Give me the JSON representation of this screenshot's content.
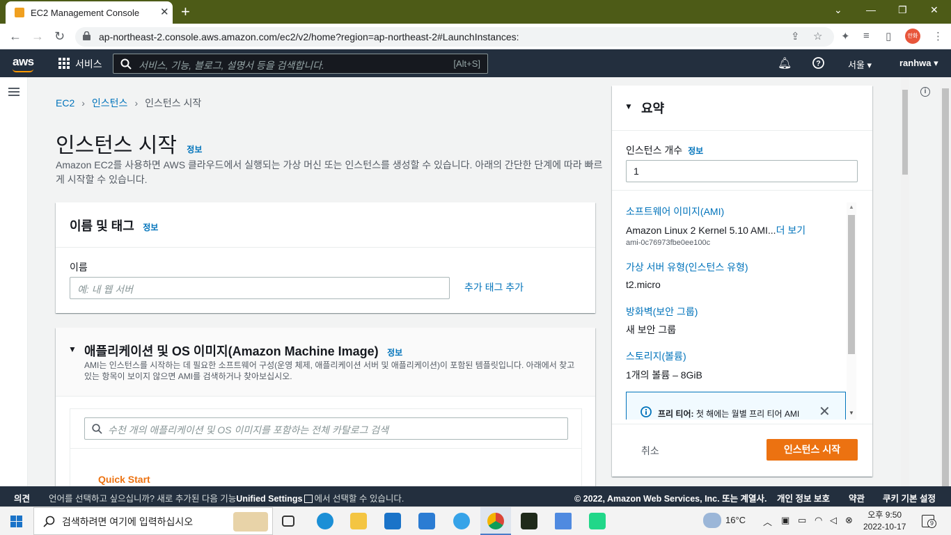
{
  "browser": {
    "tab_title": "EC2 Management Console",
    "tab_close": "✕",
    "new_tab": "+",
    "url": "ap-northeast-2.console.aws.amazon.com/ec2/v2/home?region=ap-northeast-2#LaunchInstances:",
    "profile_label": "란화",
    "window_controls": [
      "⌄",
      "—",
      "❐",
      "✕"
    ]
  },
  "aws_header": {
    "logo": "aws",
    "services_label": "서비스",
    "search_placeholder": "서비스, 기능, 블로그, 설명서 등을 검색합니다.",
    "search_shortcut": "[Alt+S]",
    "region": "서울 ▾",
    "user": "ranhwa ▾"
  },
  "breadcrumb": [
    "EC2",
    "인스턴스",
    "인스턴스 시작"
  ],
  "page": {
    "title": "인스턴스 시작",
    "info": "정보",
    "description": "Amazon EC2를 사용하면 AWS 클라우드에서 실행되는 가상 머신 또는 인스턴스를 생성할 수 있습니다. 아래의 간단한 단계에 따라 빠르게 시작할 수 있습니다."
  },
  "name_tags": {
    "header": "이름 및 태그",
    "info": "정보",
    "name_label": "이름",
    "name_placeholder": "예: 내 웹 서버",
    "add_tag": "추가 태그 추가"
  },
  "ami": {
    "header": "애플리케이션 및 OS 이미지(Amazon Machine Image)",
    "info": "정보",
    "description": "AMI는 인스턴스를 시작하는 데 필요한 소프트웨어 구성(운영 체제, 애플리케이션 서버 및 애플리케이션)이 포함된 템플릿입니다. 아래에서 찾고 있는 항목이 보이지 않으면 AMI를 검색하거나 찾아보십시오.",
    "search_placeholder": "수천 개의 애플리케이션 및 OS 이미지를 포함하는 전체 카탈로그 검색",
    "quick_start": "Quick Start"
  },
  "summary": {
    "header": "요약",
    "count_label": "인스턴스 개수",
    "count_info": "정보",
    "count_value": "1",
    "ami_link": "소프트웨어 이미지(AMI)",
    "ami_value": "Amazon Linux 2 Kernel 5.10 AMI...",
    "ami_more": "더 보기",
    "ami_id": "ami-0c76973fbe0ee100c",
    "type_link": "가상 서버 유형(인스턴스 유형)",
    "type_value": "t2.micro",
    "firewall_link": "방화벽(보안 그룹)",
    "firewall_value": "새 보안 그룹",
    "storage_link": "스토리지(볼륨)",
    "storage_value": "1개의 볼륨 – 8GiB",
    "free_tier_bold": "프리 티어:",
    "free_tier_text": " 첫 해에는 월별 프리 티어 AMI",
    "cancel": "취소",
    "launch": "인스턴스 시작"
  },
  "footer": {
    "feedback": "의견",
    "language_prefix": "언어를 선택하고 싶으십니까? 새로 추가된 다음 기능",
    "unified_settings": "Unified Settings",
    "language_suffix": "에서 선택할 수 있습니다.",
    "copyright": "© 2022, Amazon Web Services, Inc. 또는 계열사.",
    "privacy": "개인 정보 보호",
    "terms": "약관",
    "cookies": "쿠키 기본 설정"
  },
  "taskbar": {
    "search_placeholder": "검색하려면 여기에 입력하십시오",
    "temperature": "16°C",
    "time": "오후 9:50",
    "date": "2022-10-17",
    "notification_count": "9"
  }
}
